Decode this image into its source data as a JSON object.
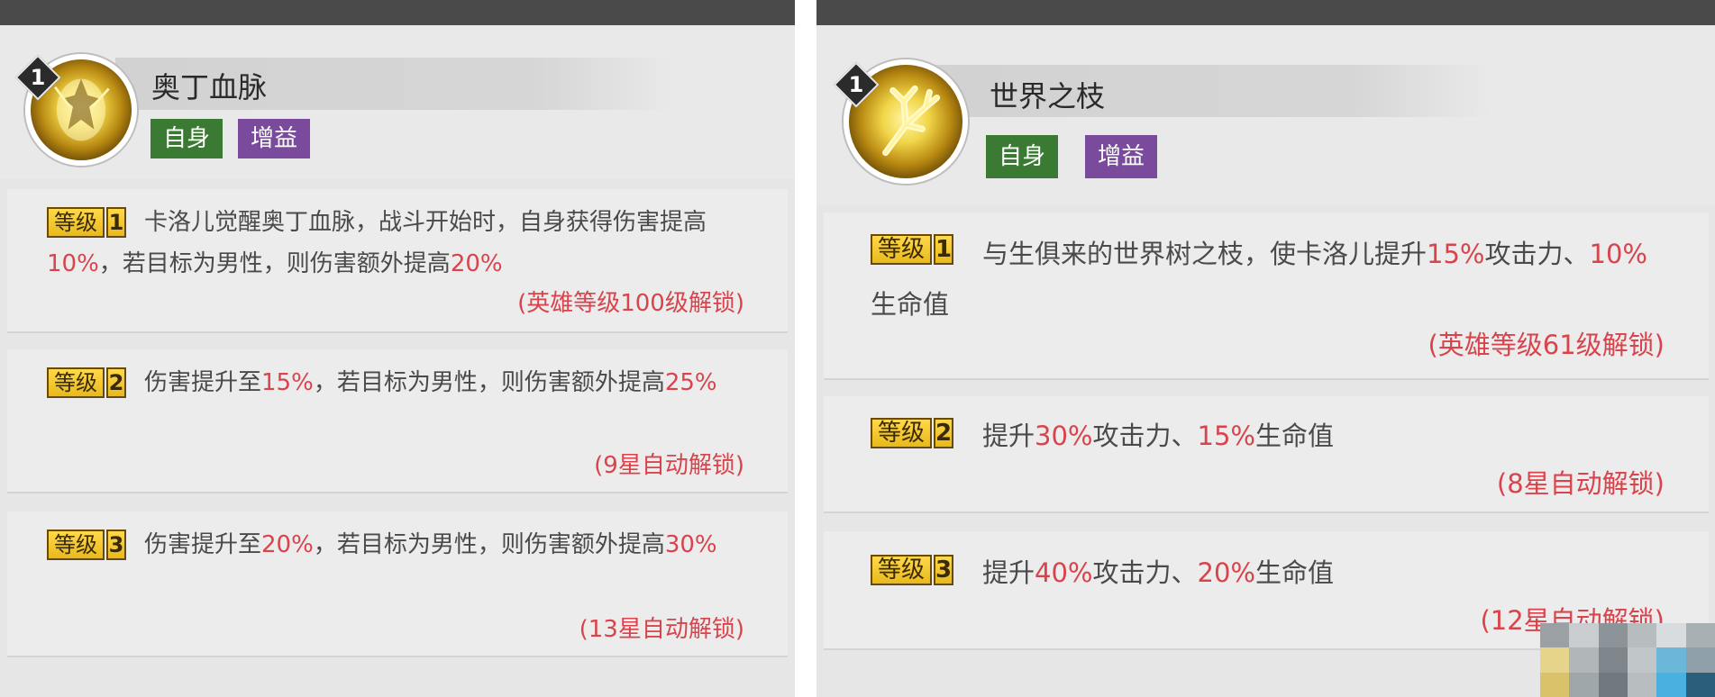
{
  "left": {
    "skill_level": "1",
    "skill_name": "奥丁血脉",
    "tags": [
      "自身",
      "增益"
    ],
    "levels": [
      {
        "badge": "等级",
        "num": "1",
        "desc": [
          {
            "t": "卡洛儿觉醒奥丁血脉，战斗开始时，自身获得伤害提高",
            "h": false
          },
          {
            "t": "10%",
            "h": true
          },
          {
            "t": "，若目标为男性，则伤害额外提高",
            "h": false
          },
          {
            "t": "20%",
            "h": true
          }
        ],
        "unlock": "(英雄等级100级解锁)"
      },
      {
        "badge": "等级",
        "num": "2",
        "desc": [
          {
            "t": "伤害提升至",
            "h": false
          },
          {
            "t": "15%",
            "h": true
          },
          {
            "t": "，若目标为男性，则伤害额外提高",
            "h": false
          },
          {
            "t": "25%",
            "h": true
          }
        ],
        "unlock": "(9星自动解锁)"
      },
      {
        "badge": "等级",
        "num": "3",
        "desc": [
          {
            "t": "伤害提升至",
            "h": false
          },
          {
            "t": "20%",
            "h": true
          },
          {
            "t": "，若目标为男性，则伤害额外提高",
            "h": false
          },
          {
            "t": "30%",
            "h": true
          }
        ],
        "unlock": "(13星自动解锁)"
      }
    ]
  },
  "right": {
    "skill_level": "1",
    "skill_name": "世界之枝",
    "tags": [
      "自身",
      "增益"
    ],
    "levels": [
      {
        "badge": "等级",
        "num": "1",
        "desc": [
          {
            "t": "与生俱来的世界树之枝，使卡洛儿提升",
            "h": false
          },
          {
            "t": "15%",
            "h": true
          },
          {
            "t": "攻击力、",
            "h": false
          },
          {
            "t": "10%",
            "h": true
          },
          {
            "t": "生命值",
            "h": false
          }
        ],
        "unlock": "(英雄等级61级解锁)"
      },
      {
        "badge": "等级",
        "num": "2",
        "desc": [
          {
            "t": "提升",
            "h": false
          },
          {
            "t": "30%",
            "h": true
          },
          {
            "t": "攻击力、",
            "h": false
          },
          {
            "t": "15%",
            "h": true
          },
          {
            "t": "生命值",
            "h": false
          }
        ],
        "unlock": "(8星自动解锁)"
      },
      {
        "badge": "等级",
        "num": "3",
        "desc": [
          {
            "t": "提升",
            "h": false
          },
          {
            "t": "40%",
            "h": true
          },
          {
            "t": "攻击力、",
            "h": false
          },
          {
            "t": "20%",
            "h": true
          },
          {
            "t": "生命值",
            "h": false
          }
        ],
        "unlock": "(12星自动解锁)"
      }
    ]
  },
  "colors": {
    "highlight": "#d9444c",
    "tag_self": "#3b7a32",
    "tag_buff": "#7a4a9c",
    "badge_gold": "#f0c52a"
  },
  "icons": {
    "left_skill": "warrior-glow-icon",
    "right_skill": "branch-glow-icon"
  }
}
